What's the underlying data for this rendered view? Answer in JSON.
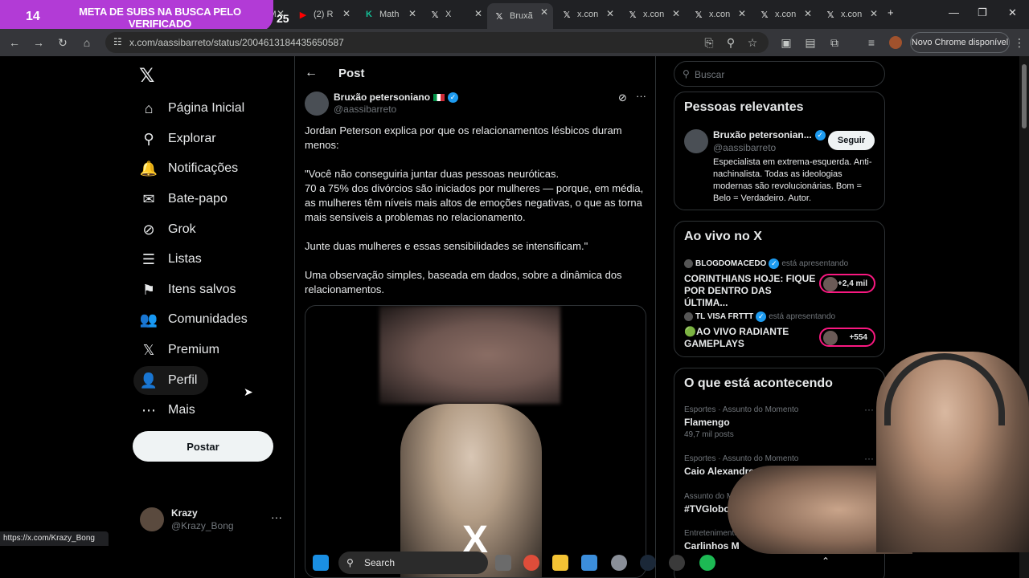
{
  "overlay": {
    "counter": "14",
    "text": "META DE SUBS NA BUSCA PELO VERIFICADO",
    "counter2": "25"
  },
  "tabs": [
    {
      "icon": "",
      "title": "(2) M"
    },
    {
      "icon": "▶",
      "title": "(2) R"
    },
    {
      "icon": "K",
      "title": "Math"
    },
    {
      "icon": "𝕏",
      "title": "X"
    },
    {
      "icon": "𝕏",
      "title": "Bruxã"
    },
    {
      "icon": "𝕏",
      "title": "x.con"
    },
    {
      "icon": "𝕏",
      "title": "x.con"
    },
    {
      "icon": "𝕏",
      "title": "x.con"
    },
    {
      "icon": "𝕏",
      "title": "x.con"
    },
    {
      "icon": "𝕏",
      "title": "x.con"
    }
  ],
  "browser": {
    "url": "x.com/aassibarreto/status/2004613184435650587",
    "update_label": "Novo Chrome disponível"
  },
  "nav": {
    "logo": "𝕏",
    "items": [
      {
        "label": "Página Inicial",
        "icon": "⌂"
      },
      {
        "label": "Explorar",
        "icon": "⚲"
      },
      {
        "label": "Notificações",
        "icon": "🔔"
      },
      {
        "label": "Bate-papo",
        "icon": "✉"
      },
      {
        "label": "Grok",
        "icon": "⊘"
      },
      {
        "label": "Listas",
        "icon": "☰"
      },
      {
        "label": "Itens salvos",
        "icon": "⚑"
      },
      {
        "label": "Comunidades",
        "icon": "👥"
      },
      {
        "label": "Premium",
        "icon": "𝕏"
      },
      {
        "label": "Perfil",
        "icon": "👤"
      },
      {
        "label": "Mais",
        "icon": "⋯"
      }
    ],
    "post_button": "Postar",
    "account": {
      "name": "Krazy",
      "handle": "@Krazy_Bong",
      "more": "···"
    }
  },
  "post": {
    "header": "Post",
    "author_name": "Bruxão petersoniano",
    "author_handle": "@aassibarreto",
    "paragraphs": [
      "Jordan Peterson explica por que os relacionamentos lésbicos duram menos:",
      "\"Você não conseguiria juntar duas pessoas neuróticas.\n70 a 75% dos divórcios são iniciados por mulheres — porque, em média, as mulheres têm níveis mais altos de emoções negativas, o que as torna mais sensíveis a problemas no relacionamento.",
      "Junte duas mulheres e essas sensibilidades se intensificam.\"",
      "Uma observação simples, baseada em dados, sobre a dinâmica dos relacionamentos."
    ],
    "media_logo": "X"
  },
  "right": {
    "search_placeholder": "Buscar",
    "relevant": {
      "title": "Pessoas relevantes",
      "name": "Bruxão petersonian...",
      "handle": "@aassibarreto",
      "follow": "Seguir",
      "bio": "Especialista em extrema-esquerda. Anti-nachinalista. Todas as ideologias modernas são revolucionárias. Bom = Belo = Verdadeiro. Autor."
    },
    "live": {
      "title": "Ao vivo no X",
      "items": [
        {
          "host": "BLOGDOMACEDO",
          "status": "está apresentando",
          "title": "CORINTHIANS HOJE: FIQUE POR DENTRO DAS ÚLTIMA...",
          "count": "+2,4 mil"
        },
        {
          "host": "TL VISA FRTTT",
          "status": "está apresentando",
          "title": "🟢AO VIVO RADIANTE GAMEPLAYS",
          "count": "+554"
        }
      ]
    },
    "trends": {
      "title": "O que está acontecendo",
      "items": [
        {
          "category": "Esportes · Assunto do Momento",
          "name": "Flamengo",
          "count": "49,7 mil posts"
        },
        {
          "category": "Esportes · Assunto do Momento",
          "name": "Caio Alexandre",
          "count": ""
        },
        {
          "category": "Assunto do Momento em Brasil",
          "name": "#TVGlobo60Melhor",
          "count": ""
        },
        {
          "category": "Entretenimento",
          "name": "Carlinhos M",
          "count": ""
        }
      ]
    }
  },
  "status_link": "https://x.com/Krazy_Bong",
  "taskbar": {
    "search_label": "Search"
  },
  "colors": {
    "accent": "#1d9bf0",
    "live": "#f91880",
    "banner": "#b23bd6"
  }
}
